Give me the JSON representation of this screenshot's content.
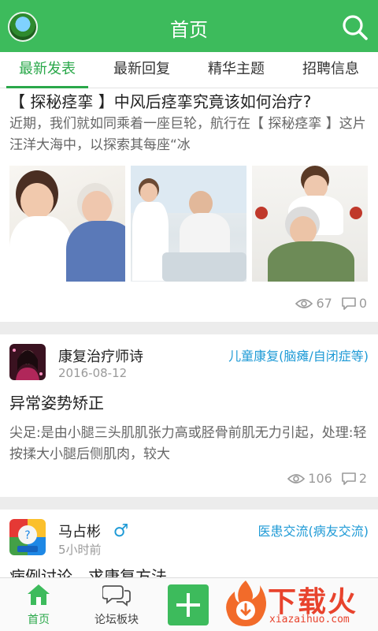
{
  "header": {
    "title": "首页"
  },
  "tabs": [
    {
      "label": "最新发表",
      "active": true
    },
    {
      "label": "最新回复",
      "active": false
    },
    {
      "label": "精华主题",
      "active": false
    },
    {
      "label": "招聘信息",
      "active": false
    }
  ],
  "posts": [
    {
      "title": "【 探秘痉挛 】中风后痉挛究竟该如何治疗?",
      "excerpt": "近期，我们就如同乘着一座巨轮，航行在【 探秘痉挛 】这片汪洋大海中，以探索其每座“冰",
      "views": "67",
      "comments": "0"
    },
    {
      "author": "康复治疗师诗",
      "time": "2016-08-12",
      "forum": "儿童康复(脑瘫/自闭症等)",
      "title": "异常姿势矫正",
      "excerpt": "尖足:是由小腿三头肌肌张力高或胫骨前肌无力引起，处理:轻按揉大小腿后侧肌肉，较大",
      "views": "106",
      "comments": "2"
    },
    {
      "author": "马占彬",
      "author_gender": "♂",
      "time": "5小时前",
      "forum": "医患交流(病友交流)",
      "title": "病例讨论，求康复方法"
    }
  ],
  "bottom_nav": {
    "home": "首页",
    "forum": "论坛板块"
  },
  "watermark": {
    "text": "下载火",
    "url": "xiazaihuo.com"
  },
  "colors": {
    "brand_green": "#3dbb5c",
    "tag_blue": "#1e9ad6",
    "watermark_red": "#e8432d"
  }
}
